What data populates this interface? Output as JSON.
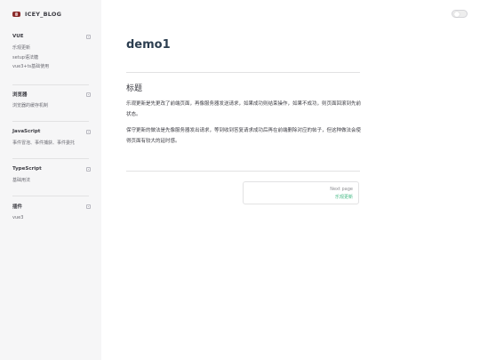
{
  "brand": {
    "title": "ICEY_BLOG"
  },
  "sidebar": {
    "groups": [
      {
        "title": "VUE",
        "items": [
          "乐观更新",
          "setup语法糖",
          "vue3+ts基础使用"
        ]
      },
      {
        "title": "浏览器",
        "items": [
          "浏览器的缓存机制"
        ]
      },
      {
        "title": "JavaScript",
        "items": [
          "事件冒泡、事件捕获、事件委托"
        ]
      },
      {
        "title": "TypeScript",
        "items": [
          "基础用法"
        ]
      },
      {
        "title": "插件",
        "items": [
          "vue3"
        ]
      }
    ]
  },
  "page": {
    "title": "demo1",
    "heading": "标题",
    "paragraphs": [
      "乐观更新是先更改了前端页面，再像服务器发送请求，如果成功则结束操作，如果不成功，则页面回滚到先前状态。",
      "保守更新的做法是先像服务器发出请求，等到收到答复请求成功后再在前端删除对应的帖子，但这种做法会使得页面有较大的延时感。"
    ]
  },
  "pager": {
    "next_desc": "Next page",
    "next_title": "乐观更新"
  },
  "colors": {
    "accent": "#42b883",
    "sidebar_bg": "#f6f6f7"
  }
}
